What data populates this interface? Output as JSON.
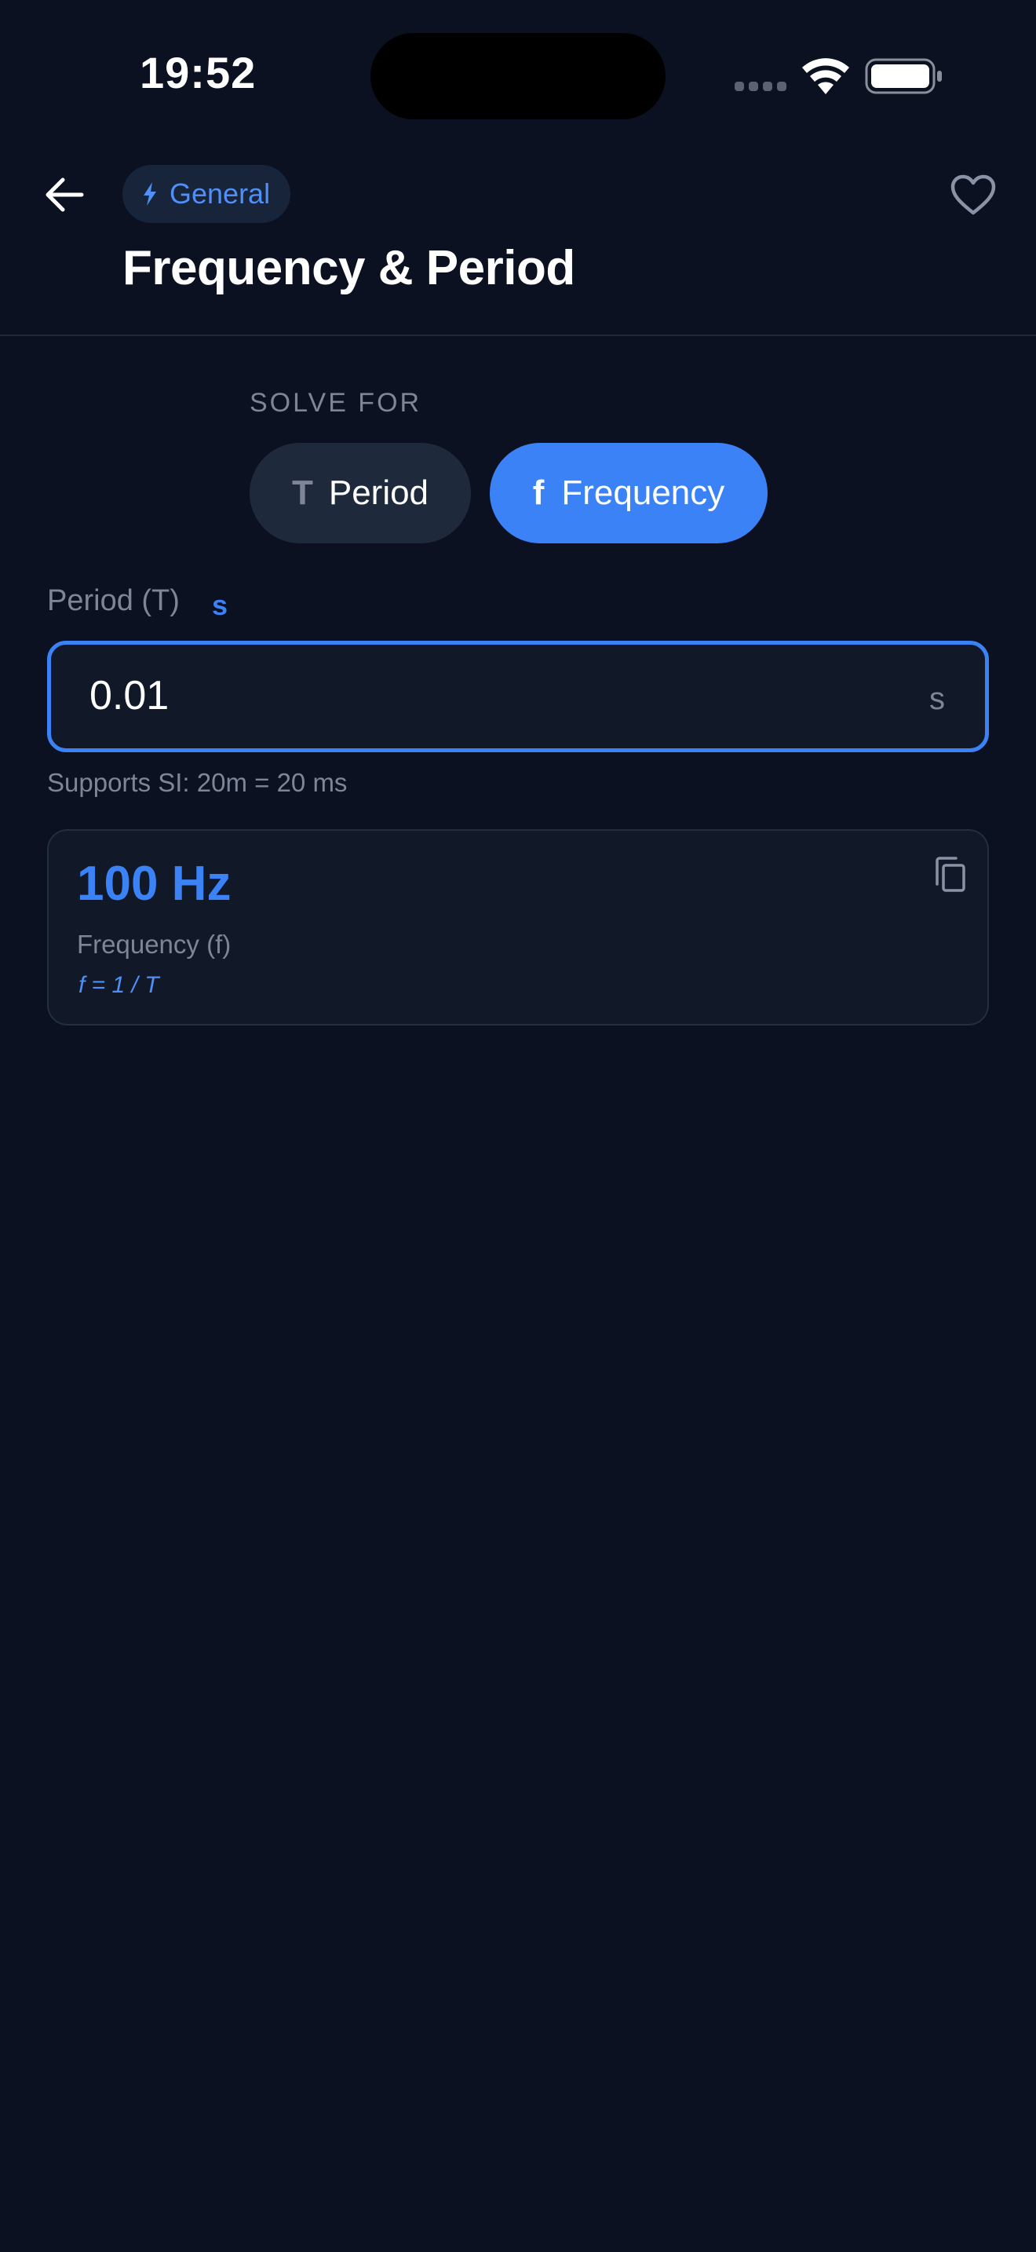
{
  "status_bar": {
    "time": "19:52",
    "wifi_icon": "wifi-icon",
    "battery_icon": "battery-icon"
  },
  "header": {
    "back_icon": "arrow-left-icon",
    "category": "General",
    "category_icon": "bolt-icon",
    "title": "Frequency & Period",
    "favorite_icon": "heart-icon"
  },
  "solve_for": {
    "label": "SOLVE FOR",
    "options": [
      {
        "symbol": "T",
        "label": "Period",
        "selected": false
      },
      {
        "symbol": "f",
        "label": "Frequency",
        "selected": true
      }
    ]
  },
  "input": {
    "label": "Period (T)",
    "unit_tag": "s",
    "value": "0.01",
    "unit": "s",
    "hint": "Supports SI: 20m = 20 ms"
  },
  "result": {
    "value": "100 Hz",
    "label": "Frequency (f)",
    "formula": "f = 1 / T",
    "copy_icon": "copy-icon"
  },
  "colors": {
    "background": "#0b1120",
    "accent": "#3b82f6",
    "muted_text": "#7d8597",
    "card": "#111827",
    "chip": "#18243a"
  }
}
